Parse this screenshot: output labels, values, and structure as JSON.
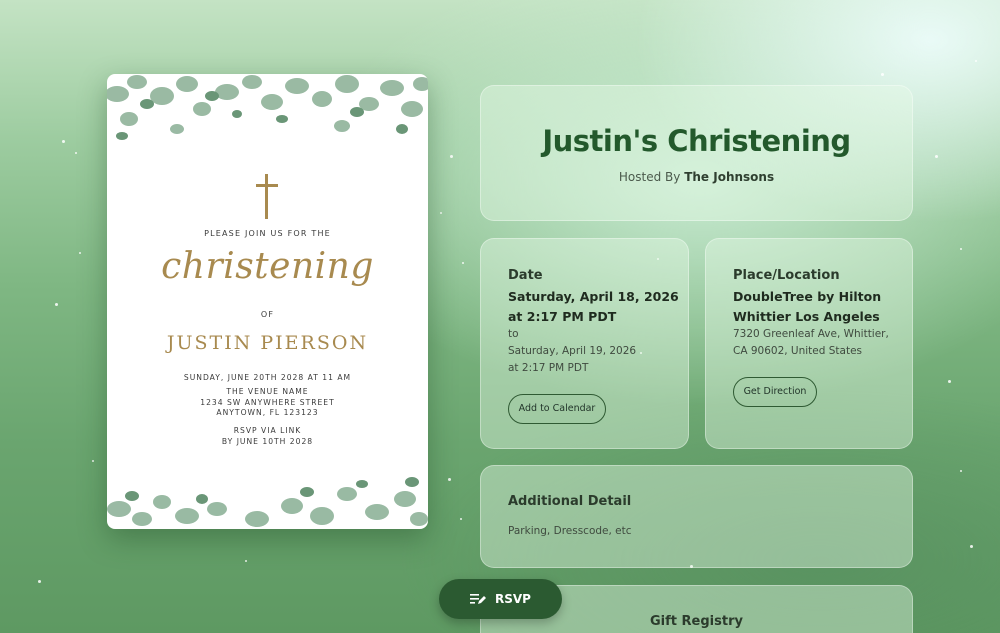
{
  "invitation": {
    "join_text": "PLEASE JOIN US FOR THE",
    "script_word": "christening",
    "of_text": "OF",
    "child_name": "JUSTIN PIERSON",
    "date_time": "SUNDAY, JUNE 20TH 2028 AT 11 AM",
    "venue_lines": [
      "THE VENUE NAME",
      "1234 SW ANYWHERE STREET",
      "ANYTOWN, FL 123123"
    ],
    "rsvp_lines": [
      "RSVP VIA LINK",
      "BY JUNE 10TH 2028"
    ]
  },
  "event": {
    "title": "Justin's Christening",
    "hosted_prefix": "Hosted By",
    "host": "The Johnsons"
  },
  "date_section": {
    "heading": "Date",
    "start_date": "Saturday, April 18, 2026",
    "start_time": "at 2:17 PM PDT",
    "to": "to",
    "end_date": "Saturday, April 19, 2026",
    "end_time": "at 2:17 PM PDT",
    "button": "Add to Calendar"
  },
  "place_section": {
    "heading": "Place/Location",
    "venue_line1": "DoubleTree by Hilton",
    "venue_line2": "Whittier Los Angeles",
    "address_line1": "7320 Greenleaf Ave, Whittier,",
    "address_line2": "CA 90602, United States",
    "button": "Get Direction"
  },
  "additional_section": {
    "heading": "Additional Detail",
    "text": "Parking, Dresscode, etc"
  },
  "gift_section": {
    "heading": "Gift Registry"
  },
  "rsvp_button": {
    "label": "RSVP",
    "icon": "edit-list-icon"
  },
  "colors": {
    "accent_green": "#2b5a31",
    "title_green": "#23592c",
    "gold": "#a88a4f"
  }
}
